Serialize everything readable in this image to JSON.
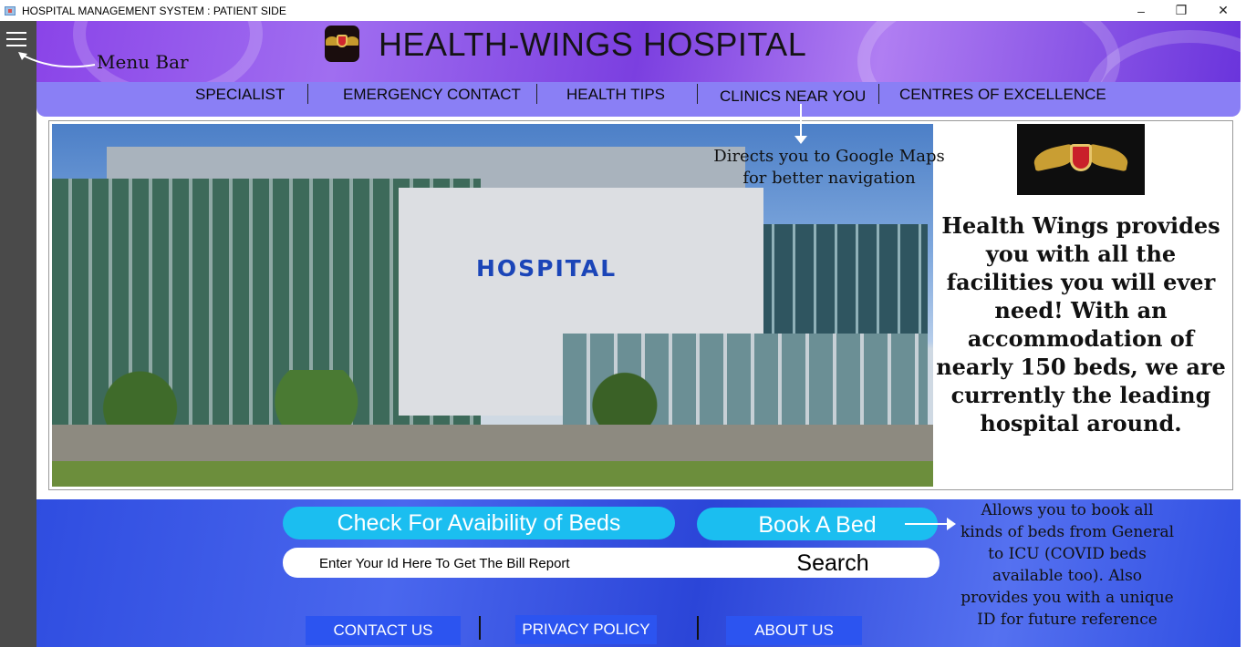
{
  "window": {
    "title": "HOSPITAL MANAGEMENT SYSTEM : PATIENT SIDE",
    "minimize": "–",
    "restore": "❐",
    "close": "✕"
  },
  "header": {
    "title": "HEALTH-WINGS HOSPITAL",
    "menu_annotation": "Menu Bar"
  },
  "nav": {
    "items": [
      "SPECIALIST",
      "EMERGENCY CONTACT",
      "HEALTH TIPS",
      "CLINICS NEAR YOU",
      "CENTRES OF EXCELLENCE"
    ]
  },
  "hero": {
    "sign": "HOSPITAL",
    "clinics_annotation": "Directs you to Google Maps for better navigation",
    "description": "Health Wings provides you with all the facilities you will ever need! With an accommodation of nearly 150 beds, we are currently the leading hospital around."
  },
  "actions": {
    "check_beds": "Check For Avaibility of Beds",
    "book_bed": "Book A Bed",
    "book_annotation": "Allows you to book all kinds of beds from General to ICU (COVID beds available too). Also provides you with a unique ID for future reference",
    "search_placeholder": "Enter Your Id Here To Get The Bill Report",
    "search_button": "Search"
  },
  "footer": {
    "contact": "CONTACT US",
    "privacy": "PRIVACY POLICY",
    "about": "ABOUT US"
  },
  "colors": {
    "sidebar": "#4a4a4a",
    "header_purple": "#8a44e8",
    "nav_lavender": "#8a7ff5",
    "bottom_blue": "#2f4de0",
    "cyan_button": "#1bbef0",
    "footer_button": "#2c54f0"
  }
}
